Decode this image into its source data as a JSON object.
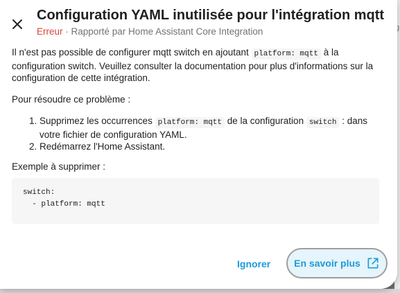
{
  "dialog": {
    "title": "Configuration YAML inutilisée pour l'intégration mqtt",
    "severity": "Erreur",
    "reporter": " · Rapporté par Home Assistant Core Integration",
    "paragraph1_a": "Il n'est pas possible de configurer mqtt switch en ajoutant ",
    "paragraph1_code": "platform: mqtt",
    "paragraph1_b": " à la configuration switch. Veuillez consulter la documentation pour plus d'informations sur la configuration de cette intégration.",
    "resolve_heading": "Pour résoudre ce problème :",
    "step1_a": "Supprimez les occurrences ",
    "step1_code1": "platform: mqtt",
    "step1_b": " de la configuration ",
    "step1_code2": "switch",
    "step1_c": " : dans votre fichier de configuration YAML.",
    "step2": "Redémarrez l'Home Assistant.",
    "example_heading": "Exemple à supprimer :",
    "example_code": "switch:\n  - platform: mqtt",
    "ignore_label": "Ignorer",
    "learn_more_label": "En savoir plus"
  },
  "icons": {
    "close": "close-icon",
    "external_link": "open-in-new-icon"
  },
  "colors": {
    "accent": "#1a9cd8",
    "error": "#db4437"
  }
}
